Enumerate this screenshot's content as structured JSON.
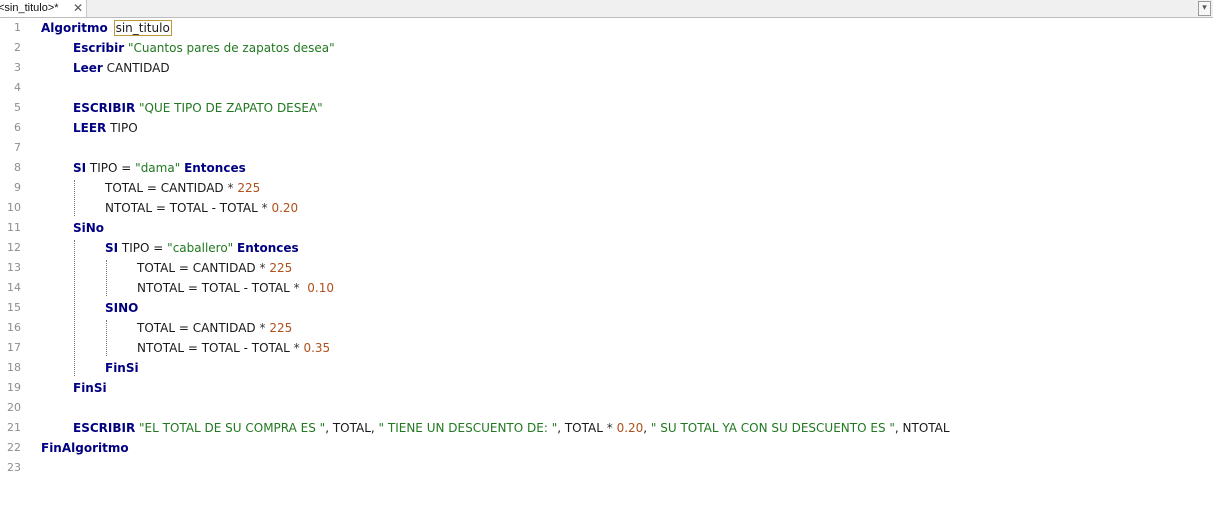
{
  "tab": {
    "title": "<sin_titulo>*",
    "close_glyph": "✕",
    "menu_glyph": "▾"
  },
  "colors": {
    "keyword": "#000080",
    "string": "#217821",
    "number": "#b0501b",
    "text": "#1a1a1a",
    "line_number": "#8e8e8e"
  },
  "lines": [
    {
      "n": "1",
      "indent": 0,
      "tokens": [
        {
          "t": "Algoritmo",
          "c": "kw"
        },
        {
          "t": " ",
          "c": "id"
        },
        {
          "t": "sin_titulo",
          "c": "title-id"
        }
      ]
    },
    {
      "n": "2",
      "indent": 1,
      "tokens": [
        {
          "t": "Escribir",
          "c": "kw"
        },
        {
          "t": " ",
          "c": "id"
        },
        {
          "t": "\"Cuantos pares de zapatos desea\"",
          "c": "str"
        }
      ]
    },
    {
      "n": "3",
      "indent": 1,
      "tokens": [
        {
          "t": "Leer",
          "c": "kw"
        },
        {
          "t": " CANTIDAD",
          "c": "id"
        }
      ]
    },
    {
      "n": "4",
      "indent": 0,
      "tokens": []
    },
    {
      "n": "5",
      "indent": 1,
      "tokens": [
        {
          "t": "ESCRIBIR",
          "c": "kw"
        },
        {
          "t": " ",
          "c": "id"
        },
        {
          "t": "\"QUE TIPO DE ZAPATO DESEA\"",
          "c": "str"
        }
      ]
    },
    {
      "n": "6",
      "indent": 1,
      "tokens": [
        {
          "t": "LEER",
          "c": "kw"
        },
        {
          "t": " TIPO",
          "c": "id"
        }
      ]
    },
    {
      "n": "7",
      "indent": 0,
      "tokens": []
    },
    {
      "n": "8",
      "indent": 1,
      "tokens": [
        {
          "t": "SI",
          "c": "kw"
        },
        {
          "t": " TIPO = ",
          "c": "id"
        },
        {
          "t": "\"dama\"",
          "c": "str"
        },
        {
          "t": " ",
          "c": "id"
        },
        {
          "t": "Entonces",
          "c": "kw"
        }
      ]
    },
    {
      "n": "9",
      "indent": 2,
      "tokens": [
        {
          "t": "TOTAL = CANTIDAD ",
          "c": "id"
        },
        {
          "t": "*",
          "c": "op"
        },
        {
          "t": " ",
          "c": "id"
        },
        {
          "t": "225",
          "c": "num"
        }
      ]
    },
    {
      "n": "10",
      "indent": 2,
      "tokens": [
        {
          "t": "NTOTAL = TOTAL - TOTAL ",
          "c": "id"
        },
        {
          "t": "*",
          "c": "op"
        },
        {
          "t": " ",
          "c": "id"
        },
        {
          "t": "0.20",
          "c": "num"
        }
      ]
    },
    {
      "n": "11",
      "indent": 1,
      "tokens": [
        {
          "t": "SiNo",
          "c": "kw"
        }
      ]
    },
    {
      "n": "12",
      "indent": 2,
      "tokens": [
        {
          "t": "SI",
          "c": "kw"
        },
        {
          "t": " TIPO = ",
          "c": "id"
        },
        {
          "t": "\"caballero\"",
          "c": "str"
        },
        {
          "t": " ",
          "c": "id"
        },
        {
          "t": "Entonces",
          "c": "kw"
        }
      ]
    },
    {
      "n": "13",
      "indent": 3,
      "tokens": [
        {
          "t": "TOTAL = CANTIDAD ",
          "c": "id"
        },
        {
          "t": "*",
          "c": "op"
        },
        {
          "t": " ",
          "c": "id"
        },
        {
          "t": "225",
          "c": "num"
        }
      ]
    },
    {
      "n": "14",
      "indent": 3,
      "tokens": [
        {
          "t": "NTOTAL = TOTAL - TOTAL ",
          "c": "id"
        },
        {
          "t": "*",
          "c": "op"
        },
        {
          "t": "  ",
          "c": "id"
        },
        {
          "t": "0.10",
          "c": "num"
        }
      ]
    },
    {
      "n": "15",
      "indent": 2,
      "tokens": [
        {
          "t": "SINO",
          "c": "kw"
        }
      ]
    },
    {
      "n": "16",
      "indent": 3,
      "tokens": [
        {
          "t": "TOTAL = CANTIDAD ",
          "c": "id"
        },
        {
          "t": "*",
          "c": "op"
        },
        {
          "t": " ",
          "c": "id"
        },
        {
          "t": "225",
          "c": "num"
        }
      ]
    },
    {
      "n": "17",
      "indent": 3,
      "tokens": [
        {
          "t": "NTOTAL = TOTAL - TOTAL ",
          "c": "id"
        },
        {
          "t": "*",
          "c": "op"
        },
        {
          "t": " ",
          "c": "id"
        },
        {
          "t": "0.35",
          "c": "num"
        }
      ]
    },
    {
      "n": "18",
      "indent": 2,
      "tokens": [
        {
          "t": "FinSi",
          "c": "kw"
        }
      ]
    },
    {
      "n": "19",
      "indent": 1,
      "tokens": [
        {
          "t": "FinSi",
          "c": "kw"
        }
      ]
    },
    {
      "n": "20",
      "indent": 0,
      "tokens": []
    },
    {
      "n": "21",
      "indent": 1,
      "tokens": [
        {
          "t": "ESCRIBIR",
          "c": "kw"
        },
        {
          "t": " ",
          "c": "id"
        },
        {
          "t": "\"EL TOTAL DE SU COMPRA ES \"",
          "c": "str"
        },
        {
          "t": ", TOTAL, ",
          "c": "id"
        },
        {
          "t": "\" TIENE UN DESCUENTO DE: \"",
          "c": "str"
        },
        {
          "t": ", TOTAL ",
          "c": "id"
        },
        {
          "t": "*",
          "c": "op"
        },
        {
          "t": " ",
          "c": "id"
        },
        {
          "t": "0.20",
          "c": "num"
        },
        {
          "t": ", ",
          "c": "id"
        },
        {
          "t": "\" SU TOTAL YA CON SU DESCUENTO ES \"",
          "c": "str"
        },
        {
          "t": ", NTOTAL",
          "c": "id"
        }
      ]
    },
    {
      "n": "22",
      "indent": 0,
      "tokens": [
        {
          "t": "FinAlgoritmo",
          "c": "kw"
        }
      ]
    },
    {
      "n": "23",
      "indent": 0,
      "tokens": []
    }
  ]
}
